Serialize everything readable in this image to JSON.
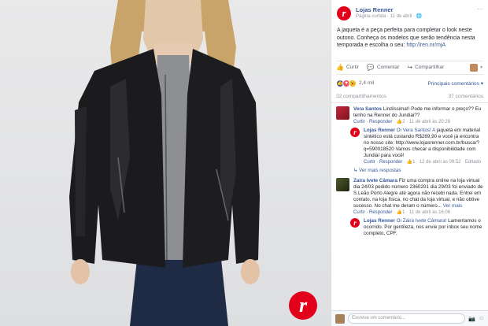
{
  "post": {
    "page_name": "Lojas Renner",
    "meta": "Página curtida · 11 de abril · ",
    "text": "A jaqueta é a peça perfeita para completar o look neste outono. Conheça os modelos que serão tendência nesta temporada e escolha o seu: ",
    "link": "http://ren.nr/mjA",
    "logo_letter": "r"
  },
  "actions": {
    "like": "Curtir",
    "comment": "Comentar",
    "share": "Compartilhar"
  },
  "reactions": {
    "count": "2,4 mil",
    "sort_label": "Principais comentários"
  },
  "stats": {
    "shares": "32 compartilhamentos",
    "comments": "37 comentários"
  },
  "comments": [
    {
      "name": "Vera Santos",
      "text": " Lindíssima!! Pode me informar o preço?? Eu tenho na Renner do Jundiai??",
      "footer_actions": "Curtir · Responder",
      "footer_meta": " · 👍2 · 11 de abril às 20:29",
      "reply": {
        "name": "Lojas Renner",
        "mention": " Oi Vera Santos! A",
        "text": "jaqueta em material sintético está custando R$269,90 e você já encontra no nosso site: http://www.lojasrenner.com.br/busca/?q=590018520 Vamos checar a disponibilidade com Jundiaí para você!",
        "footer_actions": "Curtir · Responder",
        "footer_meta": " · 👍1 · 12 de abril às 09:52 · Editado"
      },
      "more_replies": "↳ Ver mais respostas"
    },
    {
      "name": "Zaira Ivete Câmara",
      "text": " Fiz uma compra online na loja virtual dia 24/03 pedido número 2360201 dia 29/03 foi enviado de S.Leão Porto Alegre até agora não recebi nada. Entrei em contato, na loja física, no chat da loja virtual, e não obtive sucesso. No chat me deram o número... ",
      "see_more": "Ver mais",
      "footer_actions": "Curtir · Responder",
      "footer_meta": " · 👍1 · 11 de abril às 16:06",
      "reply": {
        "name": "Lojas Renner",
        "mention": " Oi Zaira Ivete Câmara!",
        "text": "Lamentamos o ocorrido. Por gentileza, nos envie por inbox seu nome completo, CPF,"
      }
    }
  ],
  "write_comment": {
    "placeholder": "Escreva um comentário..."
  },
  "colors": {
    "brand": "#e3001b",
    "link": "#365899"
  }
}
